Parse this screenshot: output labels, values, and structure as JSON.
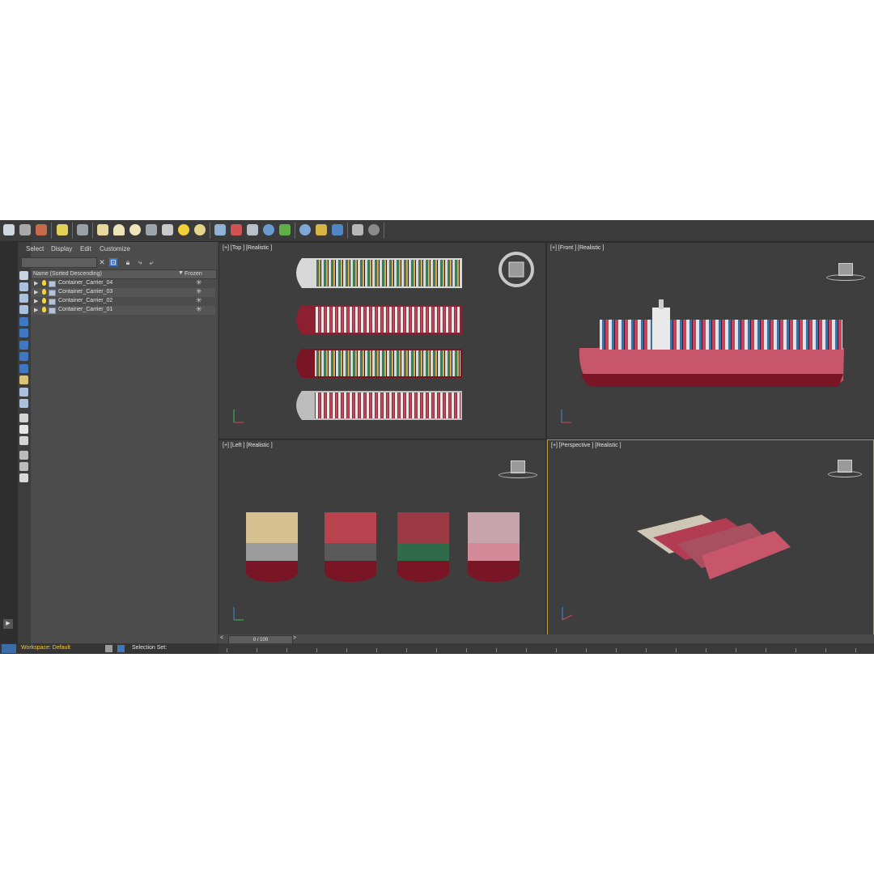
{
  "menu": {
    "items": [
      "Select",
      "Display",
      "Edit",
      "Customize"
    ]
  },
  "explorer": {
    "header_name": "Name (Sorted Descending)",
    "header_frozen": "Frozen",
    "rows": [
      "Container_Carrier_04",
      "Container_Carrier_03",
      "Container_Carrier_02",
      "Container_Carrier_01"
    ]
  },
  "viewports": {
    "top": "[+] [Top ] [Realistic ]",
    "front": "[+] [Front ] [Realistic ]",
    "left": "[+] [Left ] [Realistic ]",
    "perspective": "[+] [Perspective ] [Realistic ]"
  },
  "timeline": {
    "frame": "0 / 100"
  },
  "status": {
    "workspace": "Workspace: Default",
    "selection_set": "Selection Set:"
  },
  "colors": {
    "hull_red": "#7a1525",
    "hull_pink": "#c8566b",
    "active_viewport_border": "#b59a3c",
    "bulb": "#f3d43b"
  }
}
